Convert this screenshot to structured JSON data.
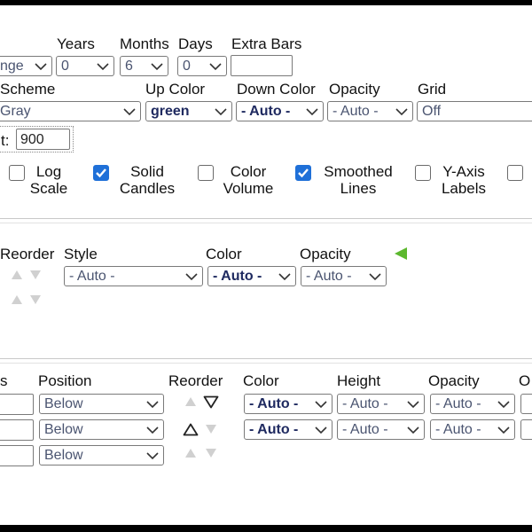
{
  "range_section": {
    "range_value": "nge",
    "labels": {
      "years": "Years",
      "months": "Months",
      "days": "Days",
      "extra_bars": "Extra Bars"
    },
    "years": "0",
    "months": "6",
    "days": "0",
    "extra_bars": ""
  },
  "scheme_section": {
    "labels": {
      "scheme": "Scheme",
      "up_color": "Up Color",
      "down_color": "Down Color",
      "opacity": "Opacity",
      "grid": "Grid"
    },
    "scheme": "Gray",
    "up_color": "green",
    "down_color": "- Auto -",
    "opacity": "- Auto -",
    "grid": "Off",
    "height_label": "t:",
    "height_value": "900"
  },
  "options": [
    {
      "line1": "Log",
      "line2": "Scale",
      "checked": false
    },
    {
      "line1": "Solid",
      "line2": "Candles",
      "checked": true
    },
    {
      "line1": "Color",
      "line2": "Volume",
      "checked": false
    },
    {
      "line1": "Smoothed",
      "line2": "Lines",
      "checked": true
    },
    {
      "line1": "Y-Axis",
      "line2": "Labels",
      "checked": false
    }
  ],
  "overlays": {
    "headers": {
      "reorder": "Reorder",
      "style": "Style",
      "color": "Color",
      "opacity": "Opacity"
    },
    "style": "- Auto -",
    "color": "- Auto -",
    "opacity": "- Auto -"
  },
  "indicators": {
    "headers": {
      "params": "s",
      "position": "Position",
      "reorder": "Reorder",
      "color": "Color",
      "height": "Height",
      "opacity": "Opacity",
      "other": "O"
    },
    "rows": [
      {
        "position": "Below",
        "color": "- Auto -",
        "height": "- Auto -",
        "opacity": "- Auto -"
      },
      {
        "position": "Below",
        "color": "- Auto -",
        "height": "- Auto -",
        "opacity": "- Auto -"
      },
      {
        "position": "Below"
      }
    ]
  },
  "colors": {
    "accent_green": "#5cb82e",
    "checkbox_blue": "#1f70d8"
  }
}
